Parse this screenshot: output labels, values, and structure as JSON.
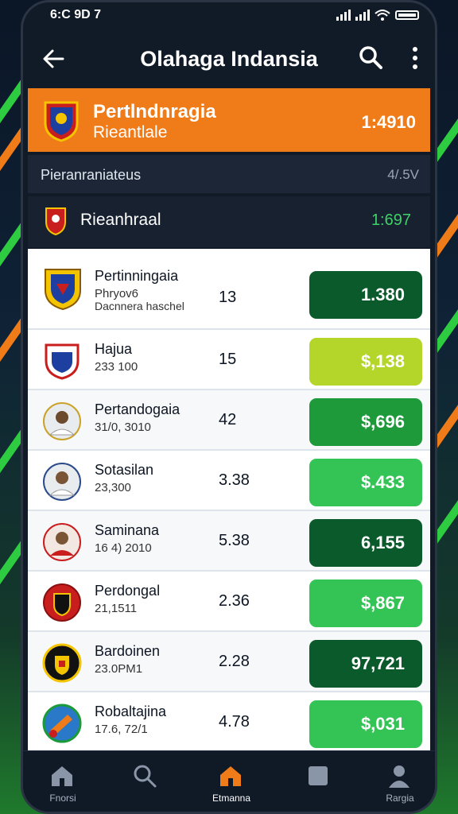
{
  "status": {
    "time": "6:C 9D 7"
  },
  "appbar": {
    "title": "Olahaga Indansia"
  },
  "hero": {
    "name": "Pertlndnragia",
    "sub": "Rieantlale",
    "odds": "1:4910"
  },
  "section": {
    "title": "Pieranraniateus",
    "right": "4/.5V"
  },
  "featured": {
    "name": "Rieanhraal",
    "odds": "1:697"
  },
  "rows": [
    {
      "name": "Pertinningaia",
      "sub": "Phryov6",
      "extra": "Dacnnera haschel",
      "num": "13",
      "odds": "1.380",
      "color": "#0b5a2b"
    },
    {
      "name": "Hajua",
      "sub": "233 100",
      "num": "15",
      "odds": "$,138",
      "color": "#b4d62b"
    },
    {
      "name": "Pertandogaia",
      "sub": "31/0, 3010",
      "num": "42",
      "odds": "$,696",
      "color": "#1e9a3a"
    },
    {
      "name": "Sotasilan",
      "sub": "23,300",
      "num": "3.38",
      "odds": "$.433",
      "color": "#34c456"
    },
    {
      "name": "Saminana",
      "sub": "16 4) 2010",
      "num": "5.38",
      "odds": "6,155",
      "color": "#0b5a2b"
    },
    {
      "name": "Perdongal",
      "sub": "21,1511",
      "num": "2.36",
      "odds": "$,867",
      "color": "#34c456"
    },
    {
      "name": "Bardoinen",
      "sub": "23.0PM1",
      "num": "2.28",
      "odds": "97,721",
      "color": "#0b5a2b"
    },
    {
      "name": "Robaltajina",
      "sub": "17.6, 72/1",
      "num": "4.78",
      "odds": "$,031",
      "color": "#34c456"
    }
  ],
  "nav": [
    {
      "label": "Fnorsi"
    },
    {
      "label": ""
    },
    {
      "label": "Etmanna"
    },
    {
      "label": ""
    },
    {
      "label": "Rargia"
    }
  ],
  "colors": {
    "accent": "#f07c19",
    "dark": "#111a27",
    "green": "#34c456"
  }
}
